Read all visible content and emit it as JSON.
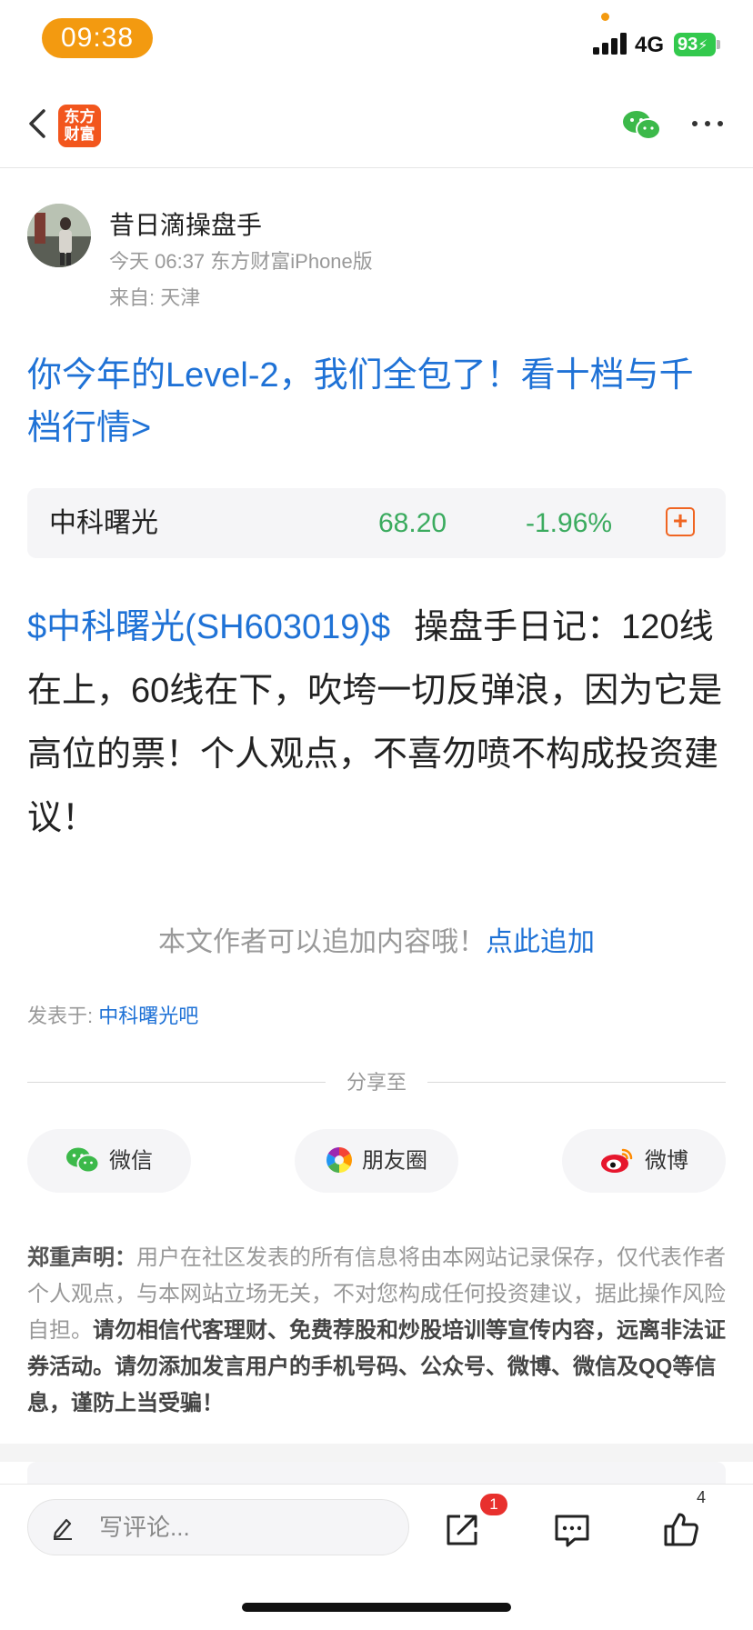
{
  "status_bar": {
    "time": "09:38",
    "network": "4G",
    "battery": "93"
  },
  "nav": {
    "logo_line1": "东方",
    "logo_line2": "财富"
  },
  "author": {
    "name": "昔日滴操盘手",
    "meta": "今天 06:37 东方财富iPhone版",
    "location": "来自: 天津"
  },
  "promo": {
    "text": "你今年的Level-2，我们全包了！看十档与千档行情>"
  },
  "stock_card": {
    "name": "中科曙光",
    "price": "68.20",
    "change": "-1.96%",
    "add_symbol": "+"
  },
  "post": {
    "stock_tag": "$中科曙光(SH603019)$",
    "text": "操盘手日记：120线在上，60线在下，吹垮一切反弹浪，因为它是高位的票！个人观点，不喜勿喷不构成投资建议！"
  },
  "append": {
    "prompt": "本文作者可以追加内容哦！",
    "link": "点此追加"
  },
  "posted_in": {
    "label": "发表于: ",
    "forum": "中科曙光吧"
  },
  "share": {
    "title": "分享至",
    "wechat": "微信",
    "moments": "朋友圈",
    "weibo": "微博"
  },
  "disclaimer": {
    "label": "郑重声明：",
    "body": "用户在社区发表的所有信息将由本网站记录保存，仅代表作者个人观点，与本网站立场无关，不对您构成任何投资建议，据此操作风险自担。",
    "warning": "请勿相信代客理财、免费荐股和炒股培训等宣传内容，远离非法证券活动。请勿添加发言用户的手机号码、公众号、微博、微信及QQ等信息，谨防上当受骗！"
  },
  "bottom_bar": {
    "comment_placeholder": "写评论...",
    "share_badge": "1",
    "like_count": "4"
  },
  "colors": {
    "link_blue": "#1f72d6",
    "stock_green": "#3bab5f",
    "brand_orange": "#f2561d",
    "badge_red": "#e8302d"
  }
}
